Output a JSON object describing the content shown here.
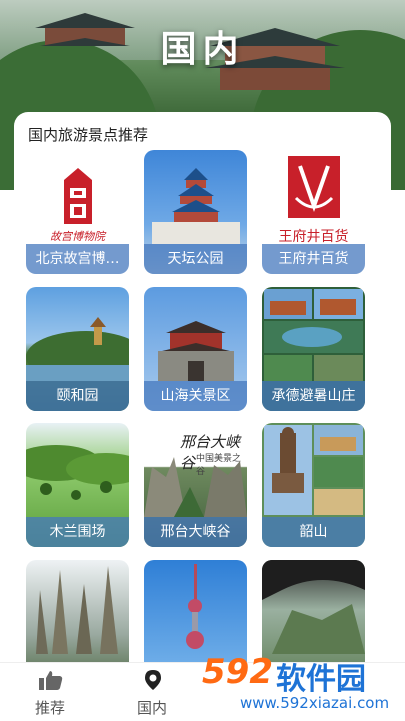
{
  "header": {
    "title": "国内"
  },
  "section": {
    "title": "国内旅游景点推荐"
  },
  "tiles": [
    {
      "label": "北京故宫博…",
      "logo_text": "故宫博物院"
    },
    {
      "label": "天坛公园"
    },
    {
      "label": "王府井百货",
      "logo_text": "王府井百货"
    },
    {
      "label": "颐和园"
    },
    {
      "label": "山海关景区"
    },
    {
      "label": "承德避暑山庄"
    },
    {
      "label": "木兰围场"
    },
    {
      "label": "邢台大峡谷",
      "sign_text": "邢台大峡谷",
      "sign_sub": "中国美景之谷"
    },
    {
      "label": "韶山"
    },
    {
      "label": ""
    },
    {
      "label": ""
    },
    {
      "label": ""
    }
  ],
  "tabbar": {
    "items": [
      {
        "label": "推荐",
        "icon": "thumbs-up-icon"
      },
      {
        "label": "国内",
        "icon": "location-pin-icon"
      }
    ]
  },
  "watermark": {
    "number": "592",
    "name": "软件园",
    "url": "www.592xiazai.com"
  },
  "colors": {
    "label_bg": "#4678be",
    "brand_red": "#c8202a",
    "watermark_orange": "#ff6a13",
    "watermark_blue": "#1e73d6"
  }
}
